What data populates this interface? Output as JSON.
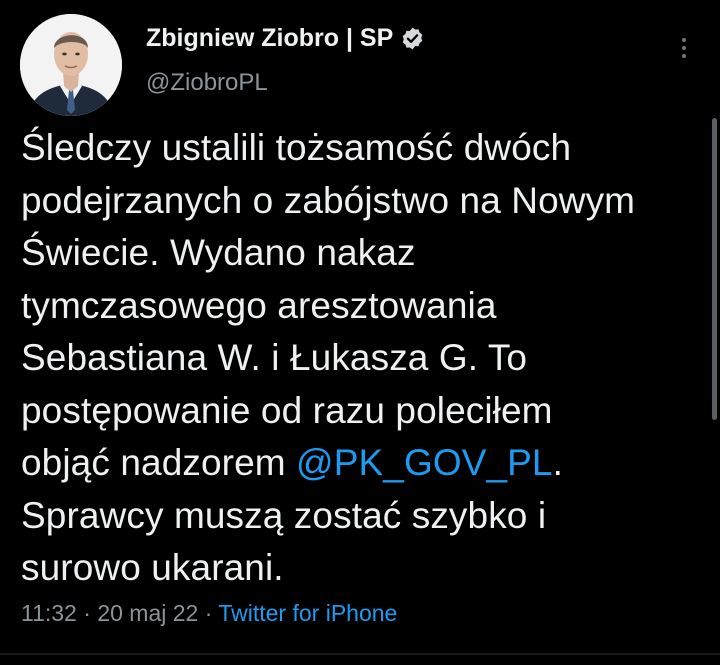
{
  "author": {
    "name": "Zbigniew Ziobro | SP",
    "handle": "@ZiobroPL",
    "avatar_icon": "profile-photo",
    "verified_icon": "verified-badge-icon"
  },
  "tweet": {
    "lines": [
      "Śledczy ustalili tożsamość dwóch",
      "podejrzanych o zabójstwo na Nowym",
      "Świecie. Wydano nakaz",
      "tymczasowego aresztowania",
      "Sebastiana W. i Łukasza G. To",
      "postępowanie od razu poleciłem"
    ],
    "line7_prefix": "objąć nadzorem ",
    "mention": "@PK_GOV_PL",
    "line7_suffix": ".",
    "line8": "Sprawcy muszą zostać szybko i",
    "line9": "surowo ukarani."
  },
  "meta": {
    "time": "11:32",
    "sep1": " · ",
    "date": "20 maj 22",
    "sep2": " · ",
    "source": "Twitter for iPhone"
  },
  "colors": {
    "background": "#000000",
    "text": "#e7e9ea",
    "muted": "#8b949b",
    "link": "#1d9bf0"
  }
}
